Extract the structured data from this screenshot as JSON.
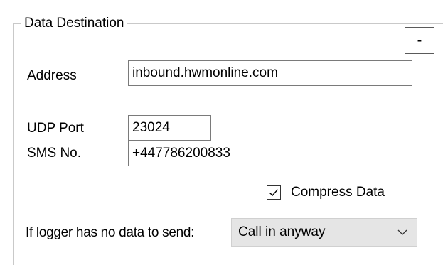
{
  "group": {
    "title": "Data Destination",
    "collapse_label": "-"
  },
  "address": {
    "label": "Address",
    "value": "inbound.hwmonline.com"
  },
  "udp_port": {
    "label": "UDP Port",
    "value": "23024"
  },
  "sms_no": {
    "label": "SMS No.",
    "value": "+447786200833"
  },
  "compress": {
    "label": "Compress Data",
    "checked": true,
    "icon": "checkmark-icon"
  },
  "no_data": {
    "label": "If logger has no data to send:",
    "selected": "Call in anyway",
    "icon": "chevron-down-icon"
  }
}
